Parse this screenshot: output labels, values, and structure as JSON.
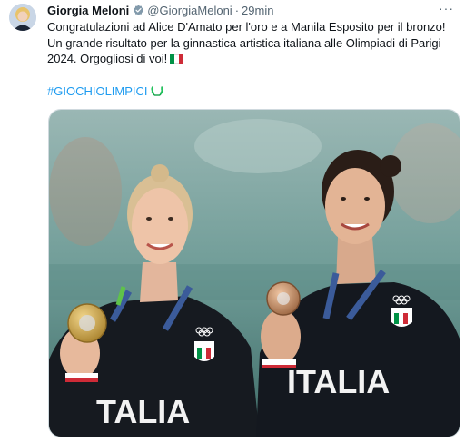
{
  "author": {
    "name": "Giorgia Meloni",
    "handle": "@GiorgiaMeloni",
    "separator": "·",
    "time": "29min"
  },
  "more_label": "···",
  "body_text": "Congratulazioni ad Alice D'Amato per l'oro e a Manila Esposito per il bronzo! Un grande risultato per la ginnastica artistica italiana alle Olimpiadi di Parigi 2024. Orgogliosi di voi!",
  "hashtag": "#GIOCHIOLIMPICI",
  "media": {
    "jersey_text_left": "TALIA",
    "jersey_text_right": "ITALIA",
    "badge_text": "ITALIA"
  },
  "colors": {
    "verified": "#829aab",
    "hashtag": "#1d9bf0",
    "flag_green": "#009246",
    "flag_white": "#ffffff",
    "flag_red": "#ce2b37",
    "gold_medal": "#c9a449",
    "bronze_medal": "#c98d61"
  }
}
